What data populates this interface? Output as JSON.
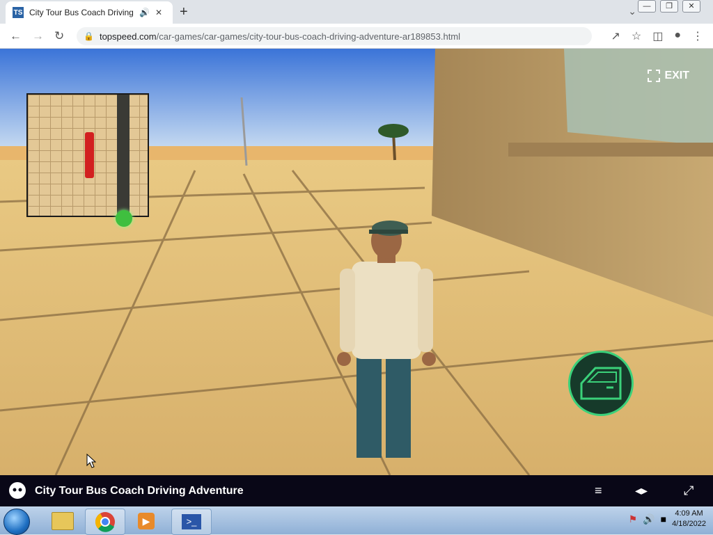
{
  "browser": {
    "tab_title": "City Tour Bus Coach Driving",
    "favicon": "TS",
    "url_domain": "topspeed.com",
    "url_path": "/car-games/car-games/city-tour-bus-coach-driving-adventure-ar189853.html"
  },
  "game": {
    "exit_label": "EXIT",
    "title": "City Tour Bus Coach Driving Adventure"
  },
  "taskbar": {
    "time": "4:09 AM",
    "date": "4/18/2022"
  },
  "icons": [
    "speaker-icon",
    "close-icon",
    "new-tab-icon",
    "back-icon",
    "forward-icon",
    "reload-icon",
    "lock-icon",
    "share-icon",
    "star-icon",
    "sidepanel-icon",
    "profile-icon",
    "menu-icon",
    "fullscreen-icon",
    "car-door-icon",
    "gamedistribution-logo-icon",
    "list-icon",
    "theater-icon",
    "expand-icon",
    "start-orb-icon",
    "explorer-icon",
    "chrome-icon",
    "media-player-icon",
    "powershell-icon",
    "network-icon",
    "volume-icon",
    "flag-icon"
  ],
  "colors": {
    "accent_green": "#3bd17a",
    "bus_marker": "#d22020"
  }
}
